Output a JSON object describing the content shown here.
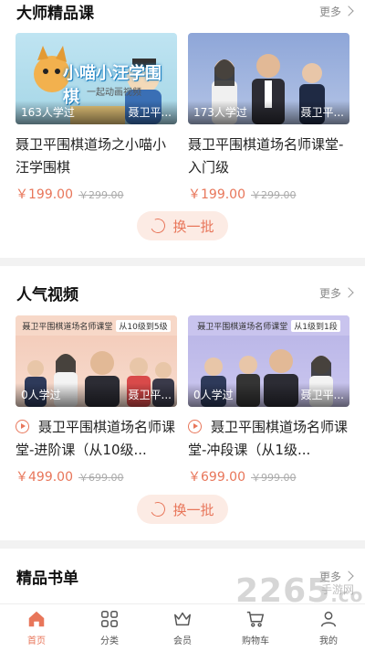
{
  "master": {
    "title": "大师精品课",
    "more": "更多",
    "cards": [
      {
        "learners": "163人学过",
        "tutor": "聂卫平...",
        "title": "聂卫平围棋道场之小喵小汪学围棋",
        "price": "￥199.00",
        "orig_price": "￥299.00",
        "art_text": "小喵小汪学围棋",
        "art_sub": "一起动画视频"
      },
      {
        "learners": "173人学过",
        "tutor": "聂卫平...",
        "title": "聂卫平围棋道场名师课堂-入门级",
        "price": "￥199.00",
        "orig_price": "￥299.00"
      }
    ],
    "swap": "换一批"
  },
  "videos": {
    "title": "人气视频",
    "more": "更多",
    "cards": [
      {
        "banner": "聂卫平围棋道场名师课堂",
        "level": "从10级到5级",
        "learners": "0人学过",
        "tutor": "聂卫平...",
        "title": "聂卫平围棋道场名师课堂-进阶课（从10级...",
        "price": "￥499.00",
        "orig_price": "￥699.00"
      },
      {
        "banner": "聂卫平围棋道场名师课堂",
        "level": "从1级到1段",
        "learners": "0人学过",
        "tutor": "聂卫平...",
        "title": "聂卫平围棋道场名师课堂-冲段课（从1级...",
        "price": "￥699.00",
        "orig_price": "￥999.00"
      }
    ],
    "swap": "换一批"
  },
  "books": {
    "title": "精品书单",
    "more": "更多"
  },
  "tabbar": [
    {
      "label": "首页",
      "icon": "home-icon",
      "active": true
    },
    {
      "label": "分类",
      "icon": "category-icon"
    },
    {
      "label": "会员",
      "icon": "crown-icon"
    },
    {
      "label": "购物车",
      "icon": "cart-icon"
    },
    {
      "label": "我的",
      "icon": "profile-icon"
    }
  ],
  "watermark": {
    "number": "2265",
    "suffix": ".com",
    "sub": "手游网"
  },
  "colors": {
    "accent": "#e8765a",
    "swap_bg": "#fcebe4",
    "divider": "#f2f2f2"
  }
}
